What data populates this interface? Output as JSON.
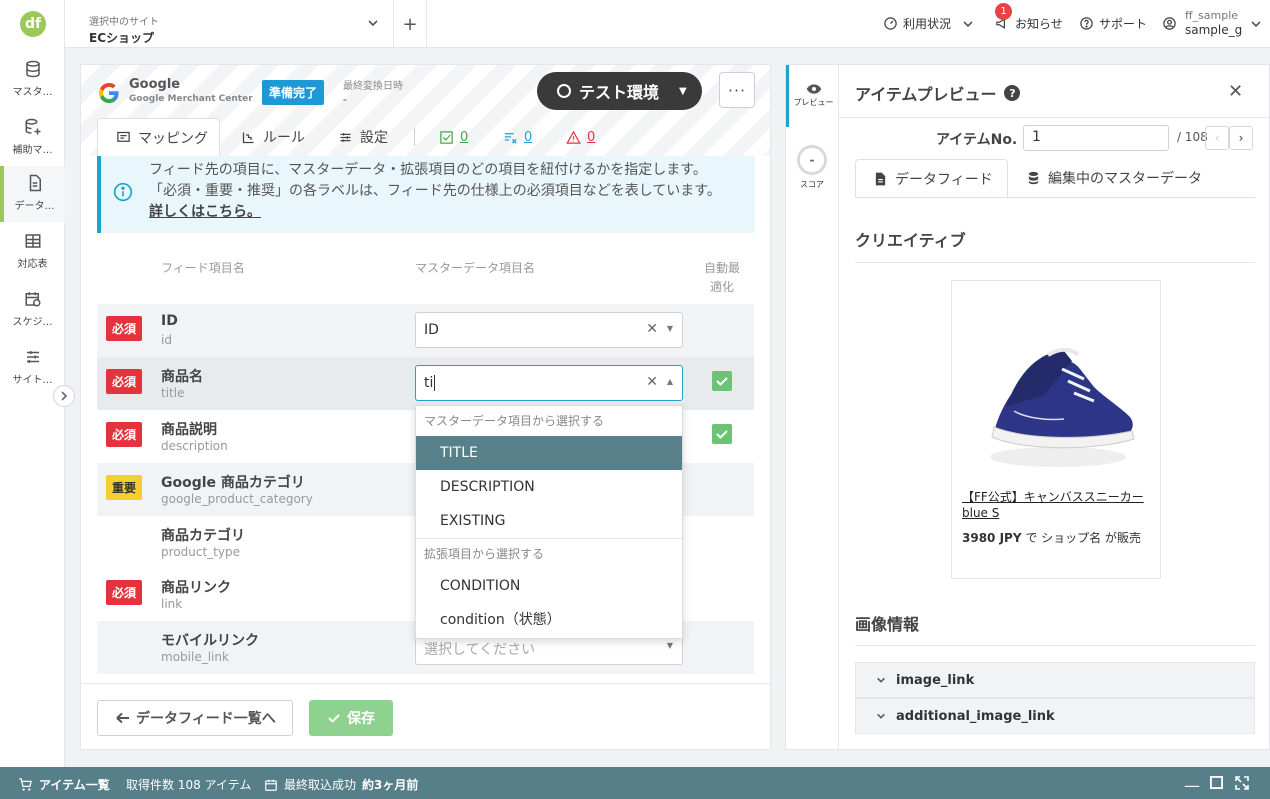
{
  "logo": "df",
  "nav": [
    {
      "label": "マスタ…",
      "icon": "database-icon"
    },
    {
      "label": "補助マ…",
      "icon": "database-plus-icon"
    },
    {
      "label": "データ…",
      "icon": "document-icon"
    },
    {
      "label": "対応表",
      "icon": "table-icon"
    },
    {
      "label": "スケジ…",
      "icon": "calendar-clock-icon"
    },
    {
      "label": "サイト…",
      "icon": "sliders-icon"
    }
  ],
  "header": {
    "site_label": "選択中のサイト",
    "site_name": "ECショップ",
    "usage": "利用状況",
    "notices": "お知らせ",
    "notice_count": "1",
    "support": "サポート",
    "user_id": "ff_sample",
    "user_name": "sample_g"
  },
  "feed": {
    "name": "Google",
    "sub": "Google Merchant Center",
    "status": "準備完了",
    "last_conv_label": "最終変換日時",
    "last_conv_value": "-",
    "env": "テスト環境"
  },
  "tabs": {
    "mapping": "マッピング",
    "rule": "ルール",
    "settings": "設定"
  },
  "counts": {
    "ok": "0",
    "excluded": "0",
    "warn": "0"
  },
  "info": {
    "line1": "フィード先の項目に、マスターデータ・拡張項目のどの項目を紐付けるかを指定します。",
    "line2": "「必須・重要・推奨」の各ラベルは、フィード先の仕様上の必須項目などを表しています。",
    "link": "詳しくはこちら。"
  },
  "table": {
    "col_feed": "フィード項目名",
    "col_master": "マスターデータ項目名",
    "col_auto": "自動最適化",
    "rows": [
      {
        "tag": "必須",
        "name": "ID",
        "key": "id",
        "value": "ID"
      },
      {
        "tag": "必須",
        "name": "商品名",
        "key": "title",
        "value": "ti"
      },
      {
        "tag": "必須",
        "name": "商品説明",
        "key": "description"
      },
      {
        "tag": "重要",
        "name": "Google 商品カテゴリ",
        "key": "google_product_category"
      },
      {
        "tag": "",
        "name": "商品カテゴリ",
        "key": "product_type"
      },
      {
        "tag": "必須",
        "name": "商品リンク",
        "key": "link"
      },
      {
        "tag": "",
        "name": "モバイルリンク",
        "key": "mobile_link",
        "placeholder": "選択してください"
      }
    ]
  },
  "dropdown": {
    "group1": "マスターデータ項目から選択する",
    "items1": [
      "TITLE",
      "DESCRIPTION",
      "EXISTING"
    ],
    "group2": "拡張項目から選択する",
    "items2": [
      "CONDITION",
      "condition（状態）"
    ]
  },
  "footer": {
    "back": "データフィード一覧へ",
    "save": "保存"
  },
  "strip": {
    "preview": "プレビュー",
    "score_value": "-",
    "score": "スコア"
  },
  "preview": {
    "title": "アイテムプレビュー",
    "item_label": "アイテムNo.",
    "item_no": "1",
    "item_total": "/ 108",
    "tab_feed": "データフィード",
    "tab_master": "編集中のマスターデータ",
    "section_creative": "クリエイティブ",
    "product_title": "【FF公式】キャンバススニーカー blue S",
    "price": "3980 JPY",
    "seller": "で ショップ名 が販売",
    "section_image": "画像情報",
    "acc1": "image_link",
    "acc2": "additional_image_link"
  },
  "bottom": {
    "items": "アイテム一覧",
    "fetched": "取得件数 108 アイテム",
    "last_import_label": "最終取込成功",
    "last_import_value": "約3ヶ月前"
  },
  "colors": {
    "accent": "#1fa3cc",
    "brand": "#9cc85a",
    "required": "#e5333d",
    "important": "#f5cf2d",
    "bar": "#567f89"
  }
}
